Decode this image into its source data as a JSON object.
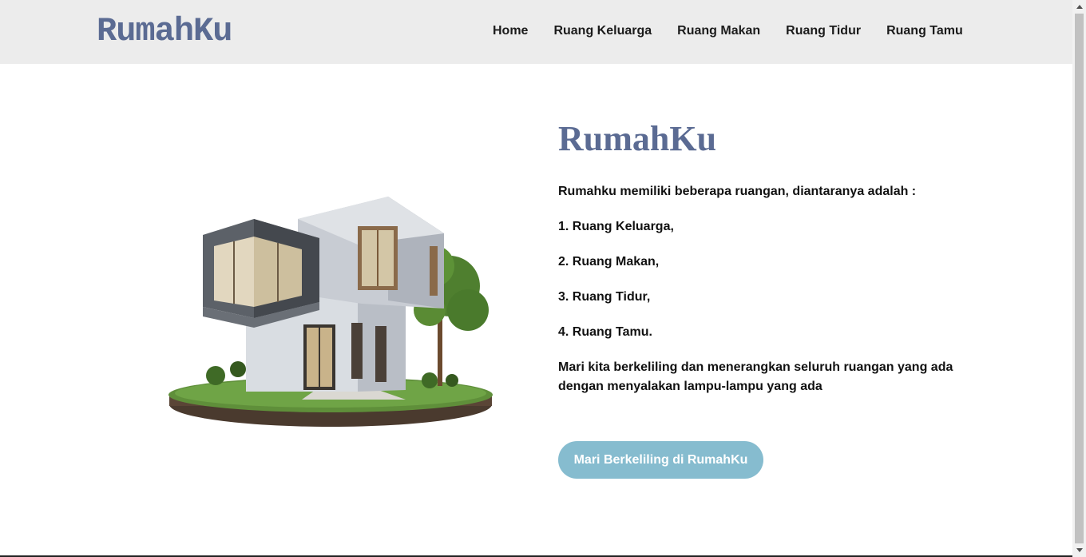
{
  "header": {
    "logo": "RumahKu",
    "nav": [
      {
        "label": "Home"
      },
      {
        "label": "Ruang Keluarga"
      },
      {
        "label": "Ruang Makan"
      },
      {
        "label": "Ruang Tidur"
      },
      {
        "label": "Ruang Tamu"
      }
    ]
  },
  "hero": {
    "image_icon": "house-illustration",
    "title": "RumahKu",
    "intro": "Rumahku memiliki beberapa ruangan, diantaranya adalah :",
    "rooms": [
      "1. Ruang Keluarga,",
      "2. Ruang Makan,",
      "3. Ruang Tidur,",
      "4. Ruang Tamu."
    ],
    "closing": "Mari kita berkeliling dan menerangkan seluruh ruangan yang ada dengan menyalakan lampu-lampu yang ada",
    "cta_label": "Mari Berkeliling di RumahKu"
  },
  "colors": {
    "brand": "#5b6b93",
    "header_bg": "#ececec",
    "button_bg": "#86bccf"
  }
}
